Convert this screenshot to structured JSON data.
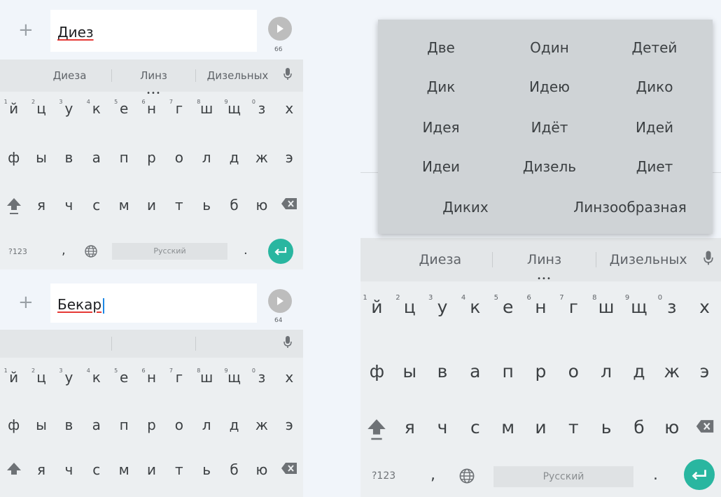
{
  "panel1": {
    "typed": "Диез",
    "count": "66",
    "suggestions": [
      "Диеза",
      "Линз",
      "Дизельных"
    ]
  },
  "panel2": {
    "typed": "Бекар",
    "count": "64"
  },
  "panel3": {
    "suggestions": [
      "Диеза",
      "Линз",
      "Дизельных"
    ],
    "popup": [
      [
        "Две",
        "Один",
        "Детей"
      ],
      [
        "Дик",
        "Идею",
        "Дико"
      ],
      [
        "Идея",
        "Идёт",
        "Идей"
      ],
      [
        "Идеи",
        "Дизель",
        "Диет"
      ],
      [
        "Диких",
        "Линзообразная"
      ]
    ]
  },
  "keyboard": {
    "row1": [
      "й",
      "ц",
      "у",
      "к",
      "е",
      "н",
      "г",
      "ш",
      "щ",
      "з",
      "х"
    ],
    "hints": [
      "1",
      "2",
      "3",
      "4",
      "5",
      "6",
      "7",
      "8",
      "9",
      "0"
    ],
    "row2": [
      "ф",
      "ы",
      "в",
      "а",
      "п",
      "р",
      "о",
      "л",
      "д",
      "ж",
      "э"
    ],
    "row3": [
      "я",
      "ч",
      "с",
      "м",
      "и",
      "т",
      "ь",
      "б",
      "ю"
    ],
    "symbols_key": "?123",
    "comma": ",",
    "space": "Русский",
    "period": "."
  },
  "icons": {
    "plus": "plus-icon",
    "send": "send-arrow-icon",
    "mic": "microphone-icon",
    "shift": "shift-arrow-icon",
    "backspace": "backspace-icon",
    "globe": "globe-icon",
    "enter": "enter-return-icon"
  },
  "colors": {
    "accent": "#29b6a0",
    "caret": "#1e88e5",
    "spellcheck": "#e53935"
  }
}
